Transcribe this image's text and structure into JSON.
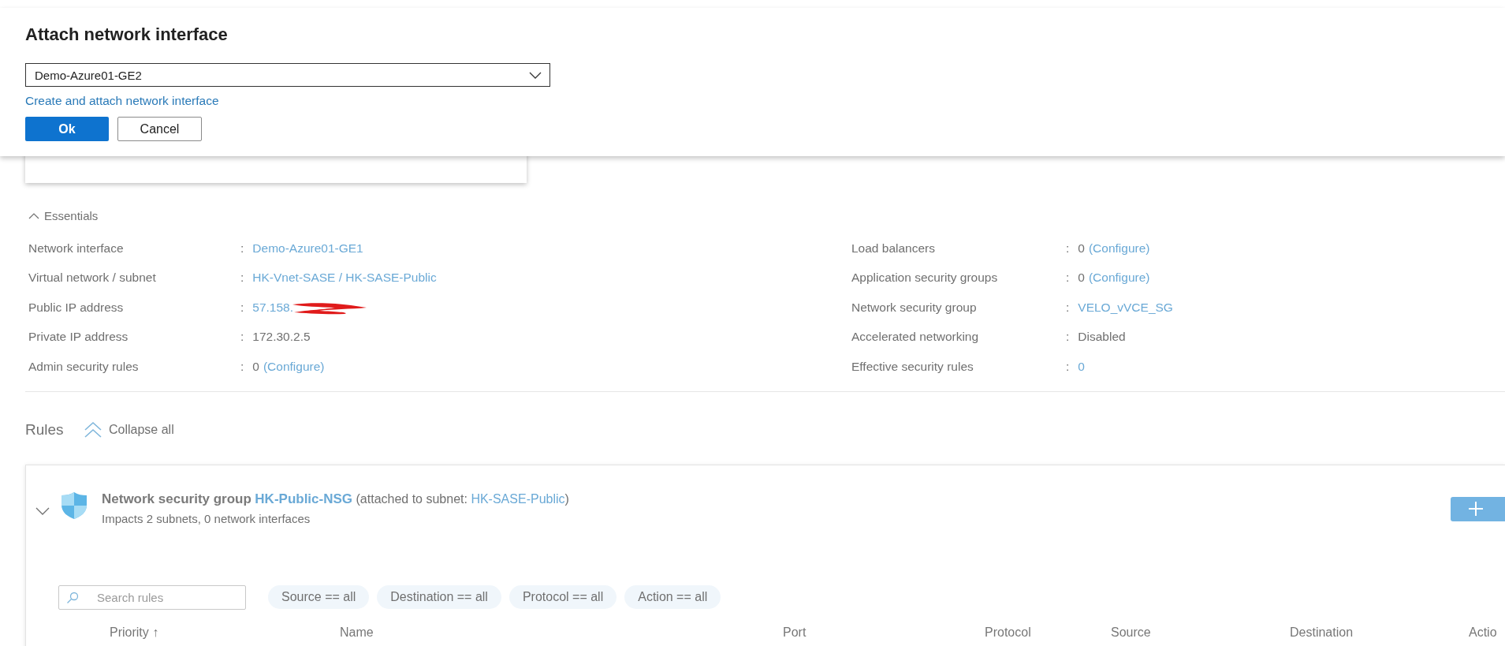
{
  "dialog": {
    "title": "Attach network interface",
    "dropdown": {
      "value": "Demo-Azure01-GE2"
    },
    "link": "Create and attach network interface",
    "buttons": [
      {
        "label": "Ok",
        "kind": "primary"
      },
      {
        "label": "Cancel",
        "kind": "secondary"
      }
    ]
  },
  "essentials": {
    "title": "Essentials",
    "expanded": true,
    "separator": ":",
    "left": [
      {
        "label": "Network interface",
        "value": [
          {
            "text": "Demo-Azure01-GE1",
            "link": true
          }
        ]
      },
      {
        "label": "Virtual network / subnet",
        "value": [
          {
            "text": "HK-Vnet-SASE / HK-SASE-Public",
            "link": true
          }
        ]
      },
      {
        "label": "Public IP address",
        "value": [
          {
            "text": "57.158.",
            "link": true
          }
        ],
        "redacted": true
      },
      {
        "label": "Private IP address",
        "value": [
          {
            "text": "172.30.2.5",
            "link": false
          }
        ]
      },
      {
        "label": "Admin security rules",
        "value": [
          {
            "text": "0",
            "link": false
          },
          {
            "text": "(Configure)",
            "link": true
          }
        ]
      }
    ],
    "right": [
      {
        "label": "Load balancers",
        "value": [
          {
            "text": "0",
            "link": false
          },
          {
            "text": "(Configure)",
            "link": true
          }
        ]
      },
      {
        "label": "Application security groups",
        "value": [
          {
            "text": "0",
            "link": false
          },
          {
            "text": "(Configure)",
            "link": true
          }
        ]
      },
      {
        "label": "Network security group",
        "value": [
          {
            "text": "VELO_vVCE_SG",
            "link": true
          }
        ]
      },
      {
        "label": "Accelerated networking",
        "value": [
          {
            "text": "Disabled",
            "link": false
          }
        ]
      },
      {
        "label": "Effective security rules",
        "value": [
          {
            "text": "0",
            "link": true
          }
        ]
      }
    ]
  },
  "rules": {
    "title": "Rules",
    "collapse_all": "Collapse all",
    "nsg": {
      "expanded": true,
      "prefix": "Network security group",
      "name": "HK-Public-NSG",
      "attached_prefix": "(attached to subnet: ",
      "subnet": "HK-SASE-Public",
      "attached_suffix": ")",
      "impacts": "Impacts 2 subnets, 0 network interfaces",
      "search": {
        "placeholder": "Search rules"
      },
      "filters": [
        "Source == all",
        "Destination == all",
        "Protocol == all",
        "Action == all"
      ],
      "columns": [
        "Priority ↑",
        "Name",
        "Port",
        "Protocol",
        "Source",
        "Destination",
        "Actio"
      ]
    }
  }
}
